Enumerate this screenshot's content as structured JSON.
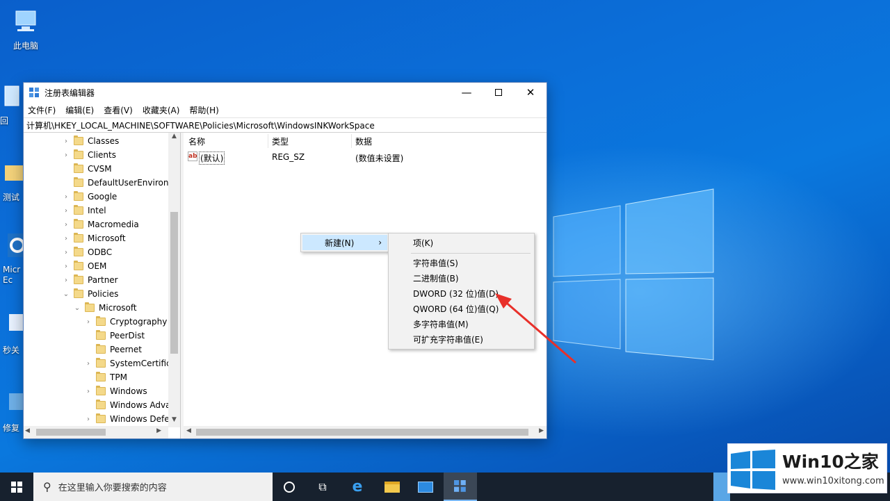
{
  "desktop": {
    "icons": [
      {
        "label": "此电脑",
        "icon": "computer-icon"
      },
      {
        "label": "回",
        "icon": "recycle-bin-icon"
      },
      {
        "label": "测试",
        "icon": "folder-icon"
      },
      {
        "label": "Micr Ec",
        "icon": "edge-icon"
      },
      {
        "label": "秒关",
        "icon": "shortcut-icon"
      },
      {
        "label": "修复",
        "icon": "repair-icon"
      }
    ]
  },
  "window": {
    "title": "注册表编辑器",
    "menu": [
      "文件(F)",
      "编辑(E)",
      "查看(V)",
      "收藏夹(A)",
      "帮助(H)"
    ],
    "address": "计算机\\HKEY_LOCAL_MACHINE\\SOFTWARE\\Policies\\Microsoft\\WindowsINKWorkSpace"
  },
  "tree": [
    {
      "label": "Classes",
      "expand": "›"
    },
    {
      "label": "Clients",
      "expand": "›"
    },
    {
      "label": "CVSM",
      "expand": ""
    },
    {
      "label": "DefaultUserEnvironm",
      "expand": ""
    },
    {
      "label": "Google",
      "expand": "›"
    },
    {
      "label": "Intel",
      "expand": "›"
    },
    {
      "label": "Macromedia",
      "expand": "›"
    },
    {
      "label": "Microsoft",
      "expand": "›"
    },
    {
      "label": "ODBC",
      "expand": "›"
    },
    {
      "label": "OEM",
      "expand": "›"
    },
    {
      "label": "Partner",
      "expand": "›"
    },
    {
      "label": "Policies",
      "expand": "⌄"
    },
    {
      "label": "Microsoft",
      "expand": "⌄"
    },
    {
      "label": "Cryptography",
      "expand": "›"
    },
    {
      "label": "PeerDist",
      "expand": ""
    },
    {
      "label": "Peernet",
      "expand": ""
    },
    {
      "label": "SystemCertifica",
      "expand": "›"
    },
    {
      "label": "TPM",
      "expand": ""
    },
    {
      "label": "Windows",
      "expand": "›"
    },
    {
      "label": "Windows Adva",
      "expand": ""
    },
    {
      "label": "Windows Defe",
      "expand": "›"
    }
  ],
  "list": {
    "headers": [
      "名称",
      "类型",
      "数据"
    ],
    "rows": [
      {
        "name": "(默认)",
        "type": "REG_SZ",
        "data": "(数值未设置)"
      }
    ]
  },
  "context_menu": {
    "new_label": "新建(N)",
    "submenu": [
      "项(K)",
      "字符串值(S)",
      "二进制值(B)",
      "DWORD (32 位)值(D)",
      "QWORD (64 位)值(Q)",
      "多字符串值(M)",
      "可扩充字符串值(E)"
    ]
  },
  "taskbar": {
    "search_placeholder": "在这里输入你要搜索的内容"
  },
  "brand": {
    "name": "Win10之家",
    "url": "www.win10xitong.com"
  },
  "colors": {
    "desktop": "#0a6fd9",
    "taskbar": "#17212e",
    "arrow": "#e8302a",
    "menu_highlight": "#cce8ff"
  }
}
